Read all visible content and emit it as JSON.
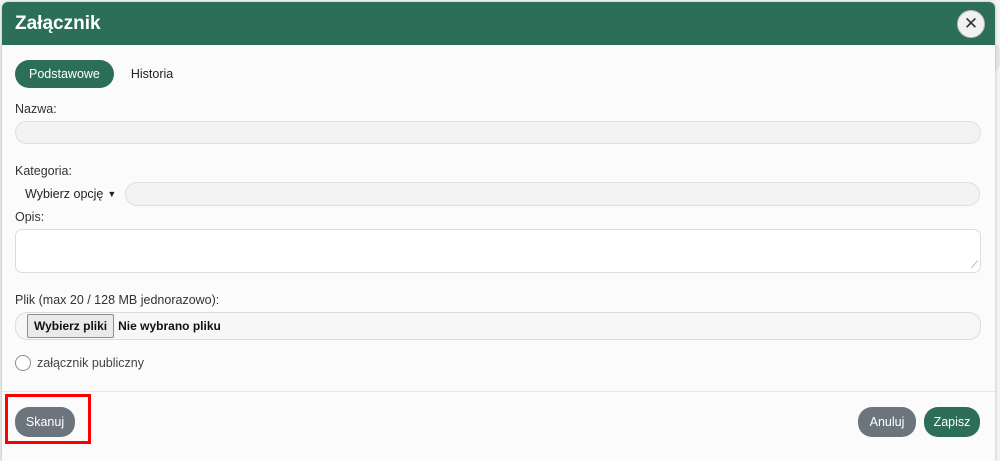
{
  "modal": {
    "title": "Załącznik",
    "close_icon": "close-icon"
  },
  "tabs": [
    {
      "label": "Podstawowe",
      "active": true
    },
    {
      "label": "Historia",
      "active": false
    }
  ],
  "form": {
    "name_label": "Nazwa:",
    "name_value": "",
    "category_label": "Kategoria:",
    "category_select": "Wybierz opcję",
    "category_value": "",
    "description_label": "Opis:",
    "description_value": "",
    "file_label": "Plik (max 20 / 128 MB jednorazowo):",
    "file_button": "Wybierz pliki",
    "file_status": "Nie wybrano pliku",
    "public_label": "załącznik publiczny",
    "public_checked": false
  },
  "footer": {
    "scan_label": "Skanuj",
    "cancel_label": "Anuluj",
    "save_label": "Zapisz"
  },
  "colors": {
    "primary": "#2c6e57",
    "secondary": "#6c757d",
    "highlight": "#ff0000"
  }
}
